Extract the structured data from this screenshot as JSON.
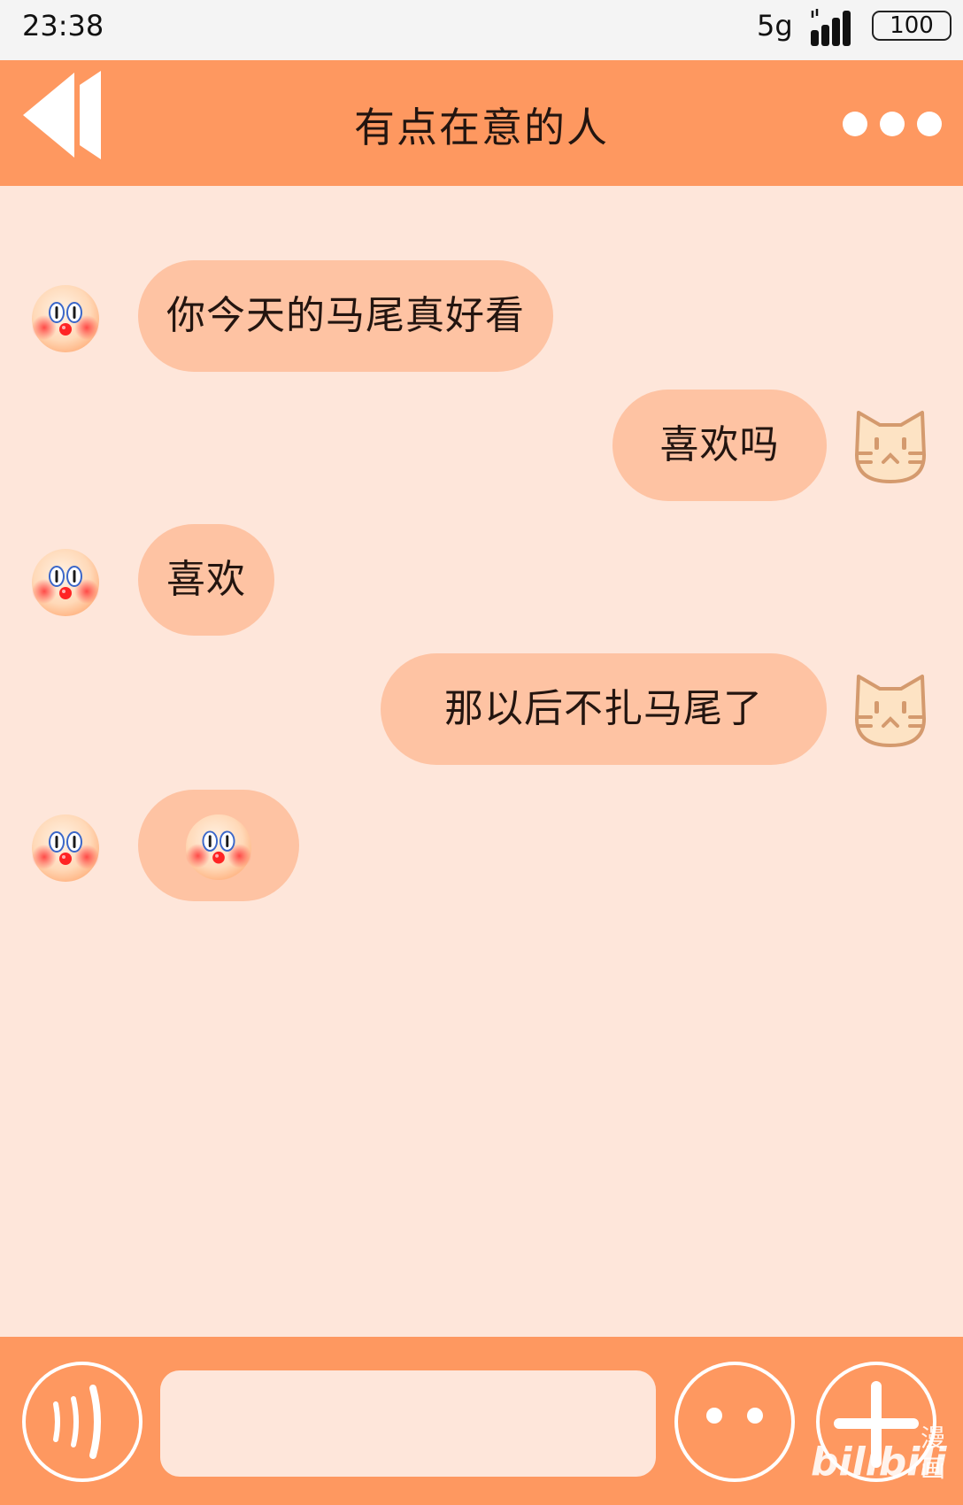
{
  "status_bar": {
    "time": "23:38",
    "network": "5g",
    "battery": "100"
  },
  "header": {
    "title": "有点在意的人",
    "back_icon": "double-chevron-left-icon",
    "more_icon": "more-dots-icon"
  },
  "messages": [
    {
      "side": "left",
      "text": "你今天的马尾真好看",
      "avatar": "clown-face-avatar"
    },
    {
      "side": "right",
      "text": "喜欢吗",
      "avatar": "cat-face-avatar"
    },
    {
      "side": "left",
      "text": "喜欢",
      "avatar": "clown-face-avatar"
    },
    {
      "side": "right",
      "text": "那以后不扎马尾了",
      "avatar": "cat-face-avatar"
    },
    {
      "side": "left",
      "emoji": "clown-face-emoji",
      "avatar": "clown-face-avatar"
    }
  ],
  "input_bar": {
    "voice_icon": "voice-wave-icon",
    "message_value": "",
    "emoji_icon": "smiley-face-icon",
    "add_icon": "plus-icon"
  },
  "watermark": {
    "brand": "bilibili",
    "label": "漫画"
  },
  "colors": {
    "accent": "#fe9860",
    "background": "#fee6da",
    "bubble": "#fec3a3",
    "status_bar": "#f4f4f4"
  }
}
